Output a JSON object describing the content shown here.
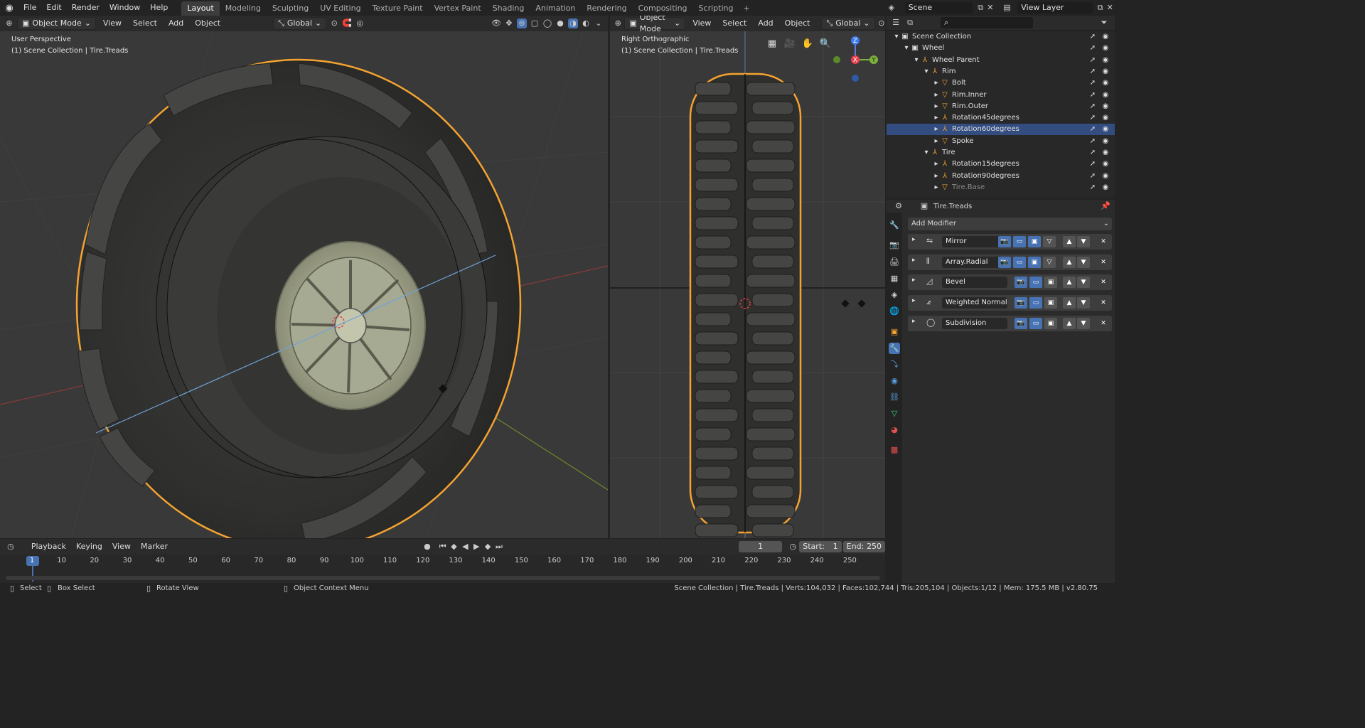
{
  "menu": [
    "File",
    "Edit",
    "Render",
    "Window",
    "Help"
  ],
  "workspaces": [
    "Layout",
    "Modeling",
    "Sculpting",
    "UV Editing",
    "Texture Paint",
    "Vertex Paint",
    "Shading",
    "Animation",
    "Rendering",
    "Compositing",
    "Scripting"
  ],
  "active_workspace": "Layout",
  "scene": {
    "name": "Scene",
    "view_layer": "View Layer"
  },
  "viewport_left": {
    "mode": "Object Mode",
    "menus": [
      "View",
      "Select",
      "Add",
      "Object"
    ],
    "orientation": "Global",
    "view_name": "User Perspective",
    "collection_label": "(1) Scene Collection | Tire.Treads"
  },
  "viewport_right": {
    "mode": "Object Mode",
    "menus": [
      "View",
      "Select",
      "Add",
      "Object"
    ],
    "orientation": "Global",
    "view_name": "Right Orthographic",
    "collection_label": "(1) Scene Collection | Tire.Treads",
    "gizmo": {
      "z": "Z",
      "x": "X",
      "y": "Y"
    }
  },
  "outliner": {
    "search_placeholder": "",
    "rows": [
      {
        "label": "Scene Collection",
        "indent": 0,
        "icon": "collection-icon",
        "selected": false
      },
      {
        "label": "Wheel",
        "indent": 1,
        "icon": "collection-icon",
        "selected": false
      },
      {
        "label": "Wheel Parent",
        "indent": 2,
        "icon": "empty-icon",
        "selected": false
      },
      {
        "label": "Rim",
        "indent": 3,
        "icon": "empty-icon",
        "selected": false
      },
      {
        "label": "Bolt",
        "indent": 4,
        "icon": "mesh-icon",
        "selected": false
      },
      {
        "label": "Rim.Inner",
        "indent": 4,
        "icon": "mesh-icon",
        "selected": false
      },
      {
        "label": "Rim.Outer",
        "indent": 4,
        "icon": "mesh-icon",
        "selected": false
      },
      {
        "label": "Rotation45degrees",
        "indent": 4,
        "icon": "empty-icon",
        "selected": false
      },
      {
        "label": "Rotation60degrees",
        "indent": 4,
        "icon": "empty-icon",
        "selected": true
      },
      {
        "label": "Spoke",
        "indent": 4,
        "icon": "mesh-icon",
        "selected": false
      },
      {
        "label": "Tire",
        "indent": 3,
        "icon": "empty-icon",
        "selected": false
      },
      {
        "label": "Rotation15degrees",
        "indent": 4,
        "icon": "empty-icon",
        "selected": false
      },
      {
        "label": "Rotation90degrees",
        "indent": 4,
        "icon": "empty-icon",
        "selected": false
      },
      {
        "label": "Tire.Base",
        "indent": 4,
        "icon": "mesh-icon",
        "selected": false
      }
    ]
  },
  "properties": {
    "object_name": "Tire.Treads",
    "add_modifier": "Add Modifier",
    "modifiers": [
      "Mirror",
      "Array.Radial",
      "Bevel",
      "Weighted Normal",
      "Subdivision"
    ]
  },
  "timeline": {
    "menus": [
      "Playback",
      "Keying",
      "View",
      "Marker"
    ],
    "current_frame": "1",
    "start_label": "Start:",
    "start": "1",
    "end_label": "End:",
    "end": "250",
    "ticks": [
      "1",
      "10",
      "20",
      "30",
      "40",
      "50",
      "60",
      "70",
      "80",
      "90",
      "100",
      "110",
      "120",
      "130",
      "140",
      "150",
      "160",
      "170",
      "180",
      "190",
      "200",
      "210",
      "220",
      "230",
      "240",
      "250"
    ]
  },
  "status": {
    "select": "Select",
    "box_select": "Box Select",
    "rotate_view": "Rotate View",
    "context_menu": "Object Context Menu",
    "stats": "Scene Collection | Tire.Treads | Verts:104,032 | Faces:102,744 | Tris:205,104 | Objects:1/12 | Mem: 175.5 MB | v2.80.75"
  }
}
